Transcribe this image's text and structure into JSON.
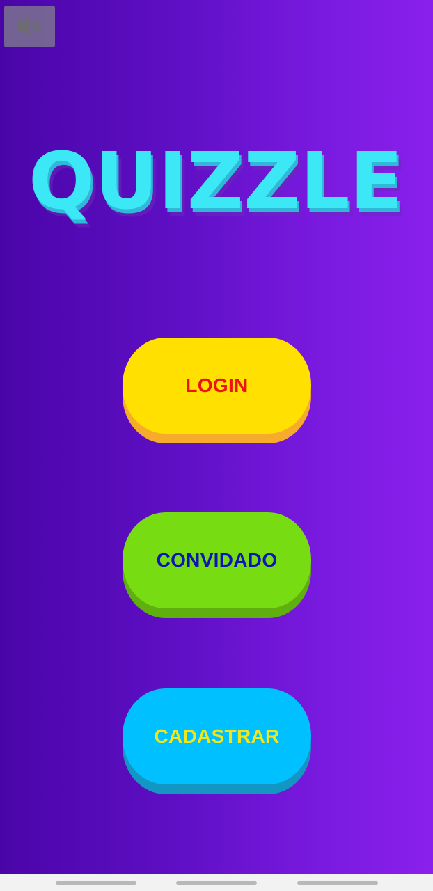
{
  "app": {
    "title": "QUIZZLE"
  },
  "mute_button": {
    "icon": "speaker-muted-icon"
  },
  "buttons": {
    "login_label": "LOGIN",
    "guest_label": "CONVIDADO",
    "register_label": "CADASTRAR"
  },
  "colors": {
    "background_left": "#4a05a8",
    "background_right": "#8a20ec",
    "logo": "#3ce8f5",
    "login_face": "#ffe000",
    "login_text": "#ec1313",
    "guest_face": "#78dc12",
    "guest_text": "#0c14b8",
    "register_face": "#00c0ff",
    "register_text": "#f2e618"
  }
}
